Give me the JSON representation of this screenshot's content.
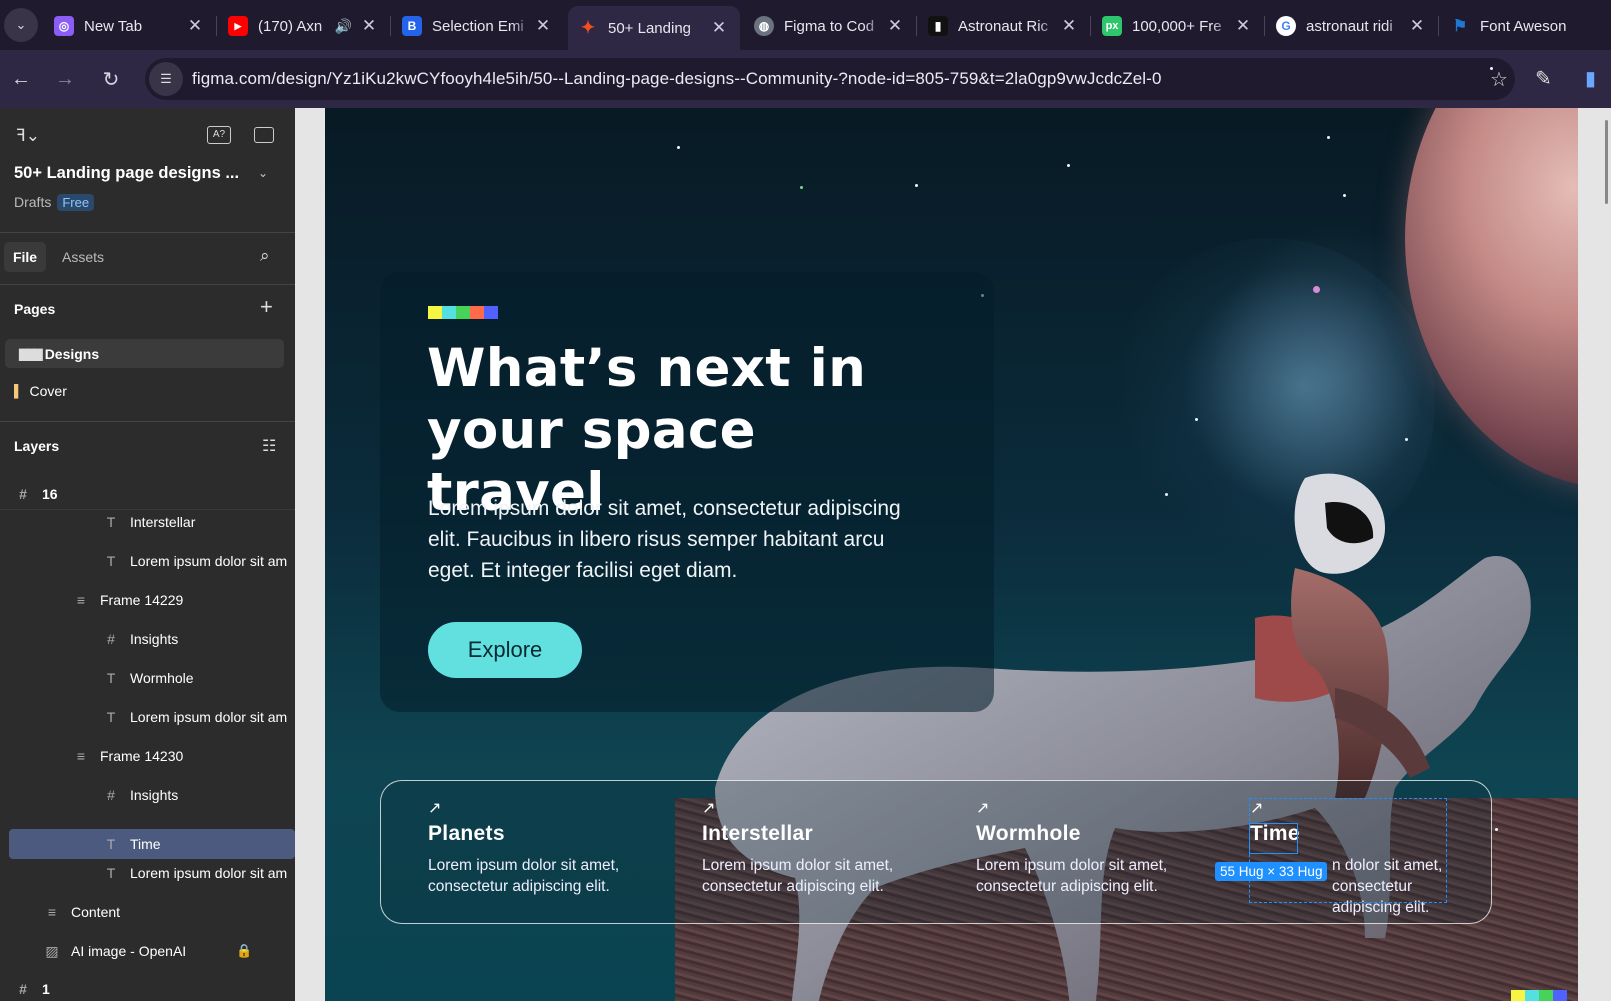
{
  "browser": {
    "tabs": [
      {
        "title": "New Tab",
        "icon": "new-tab-icon",
        "color": "#8b5cf6",
        "glyph": "◎"
      },
      {
        "title": "(170) Axn",
        "icon": "youtube-icon",
        "color": "#ff0000",
        "glyph": "▶",
        "audio": "🔊"
      },
      {
        "title": "Selection Emi",
        "icon": "selection-app-icon",
        "color": "#2563eb",
        "glyph": "B"
      },
      {
        "title": "50+ Landing",
        "icon": "figma-icon",
        "color": "#f24e1e",
        "glyph": "✦"
      },
      {
        "title": "Figma to Cod",
        "icon": "globe-icon",
        "color": "#6b7280",
        "glyph": "◍"
      },
      {
        "title": "Astronaut Ric",
        "icon": "unsplash-icon",
        "color": "#111111",
        "glyph": "▮"
      },
      {
        "title": "100,000+ Fre",
        "icon": "pixabay-icon",
        "color": "#2ec66d",
        "glyph": "px"
      },
      {
        "title": "astronaut ridi",
        "icon": "google-icon",
        "color": "#ffffff",
        "glyph": "G"
      },
      {
        "title": "Font Aweson",
        "icon": "font-awesome-icon",
        "color": "#1f78d1",
        "glyph": "⚑"
      }
    ],
    "url": "figma.com/design/Yz1iKu2kwCYfooyh4le5ih/50--Landing-page-designs--Community-?node-id=805-759&t=2la0gp9vwJcdcZel-0"
  },
  "figma": {
    "file_title": "50+ Landing page designs ...",
    "drafts_label": "Drafts",
    "plan_badge": "Free",
    "panel_tabs": {
      "file": "File",
      "assets": "Assets"
    },
    "pages_heading": "Pages",
    "pages": [
      {
        "label": "Designs",
        "icon": "▇▇▇"
      },
      {
        "label": "Cover",
        "icon": "▌"
      }
    ],
    "layers_heading": "Layers",
    "layers": [
      {
        "label": "16",
        "icon": "#"
      },
      {
        "label": "Interstellar",
        "icon": "T"
      },
      {
        "label": "Lorem ipsum dolor sit am",
        "icon": "T"
      },
      {
        "label": "Frame 14229",
        "icon": "≡"
      },
      {
        "label": "Insights",
        "icon": "#"
      },
      {
        "label": "Wormhole",
        "icon": "T"
      },
      {
        "label": "Lorem ipsum dolor sit am",
        "icon": "T"
      },
      {
        "label": "Frame 14230",
        "icon": "≡"
      },
      {
        "label": "Insights",
        "icon": "#"
      },
      {
        "label": "Time",
        "icon": "T"
      },
      {
        "label": "Lorem ipsum dolor sit am",
        "icon": "T"
      },
      {
        "label": "Content",
        "icon": "≡"
      },
      {
        "label": "AI image - OpenAI",
        "icon": "▨"
      },
      {
        "label": "1",
        "icon": "#"
      }
    ],
    "selected_layer": "Time"
  },
  "design": {
    "hero_title": "What’s next in your space travel",
    "hero_body": "Lorem ipsum dolor sit amet, consectetur adipiscing elit. Faucibus in libero risus semper habitant arcu eget. Et integer facilisi eget diam.",
    "cta_label": "Explore",
    "accent_colors": [
      "#f5f542",
      "#54e0e0",
      "#47d35a",
      "#ff6b4a",
      "#5161ff"
    ],
    "features": [
      {
        "title": "Planets",
        "desc": "Lorem ipsum dolor sit amet, consectetur adipiscing elit."
      },
      {
        "title": "Interstellar",
        "desc": "Lorem ipsum dolor sit amet, consectetur adipiscing elit."
      },
      {
        "title": "Wormhole",
        "desc": "Lorem ipsum dolor sit amet, consectetur adipiscing elit."
      },
      {
        "title": "Time",
        "desc": "n dolor sit amet, consectetur adipiscing elit."
      }
    ],
    "selection_size_label": "55 Hug × 33 Hug"
  }
}
